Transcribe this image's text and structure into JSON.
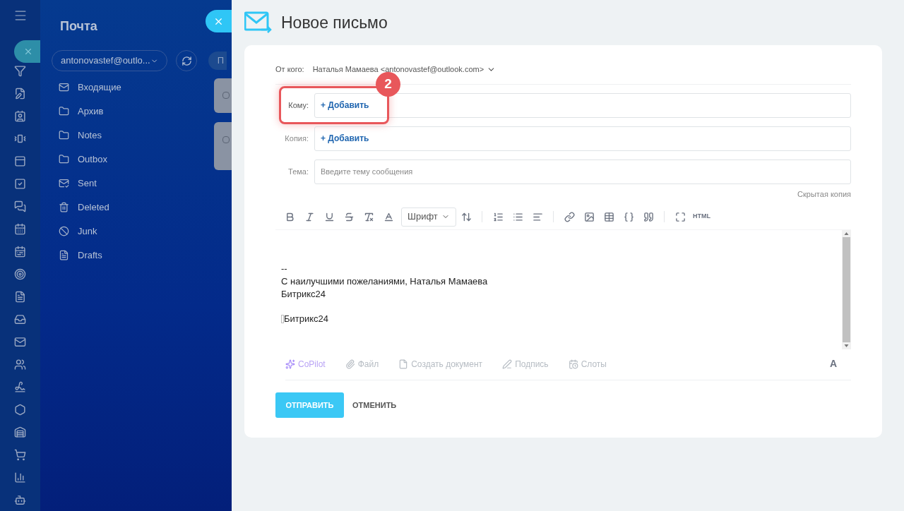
{
  "mail_panel": {
    "title": "Почта",
    "account": "antonovastef@outlo...",
    "folders": [
      {
        "label": "Входящие",
        "kind": "inbox"
      },
      {
        "label": "Архив",
        "kind": "folder"
      },
      {
        "label": "Notes",
        "kind": "folder"
      },
      {
        "label": "Outbox",
        "kind": "folder"
      },
      {
        "label": "Sent",
        "kind": "sent"
      },
      {
        "label": "Deleted",
        "kind": "trash"
      },
      {
        "label": "Junk",
        "kind": "junk"
      },
      {
        "label": "Drafts",
        "kind": "drafts"
      }
    ],
    "list_button": "П",
    "message_cards": [
      {
        "checked": false
      },
      {
        "checked": false
      }
    ]
  },
  "compose": {
    "title": "Новое письмо",
    "from_label": "От кого:",
    "from_value": "Наталья Мамаева <antonovastef@outlook.com>",
    "recipients": [
      {
        "label": "Кому:",
        "add": "+ Добавить",
        "highlighted": true,
        "step": "2"
      },
      {
        "label": "Копия:",
        "add": "+ Добавить",
        "highlighted": false
      }
    ],
    "subject": {
      "label": "Тема:",
      "placeholder": "Введите тему сообщения"
    },
    "bcc_link": "Скрытая копия",
    "font_select": "Шрифт",
    "html_button": "HTML",
    "body_lines": [
      "--",
      "С наилучшими пожеланиями, Наталья Мамаева",
      "Битрикс24"
    ],
    "broken_image_alt": "Битрикс24",
    "attachments": [
      {
        "label": "CoPilot",
        "kind": "copilot"
      },
      {
        "label": "Файл",
        "kind": "file"
      },
      {
        "label": "Создать документ",
        "kind": "document"
      },
      {
        "label": "Подпись",
        "kind": "signature"
      },
      {
        "label": "Слоты",
        "kind": "slots"
      }
    ],
    "format_toggle": "A",
    "send": "ОТПРАВИТЬ",
    "cancel": "ОТМЕНИТЬ"
  }
}
